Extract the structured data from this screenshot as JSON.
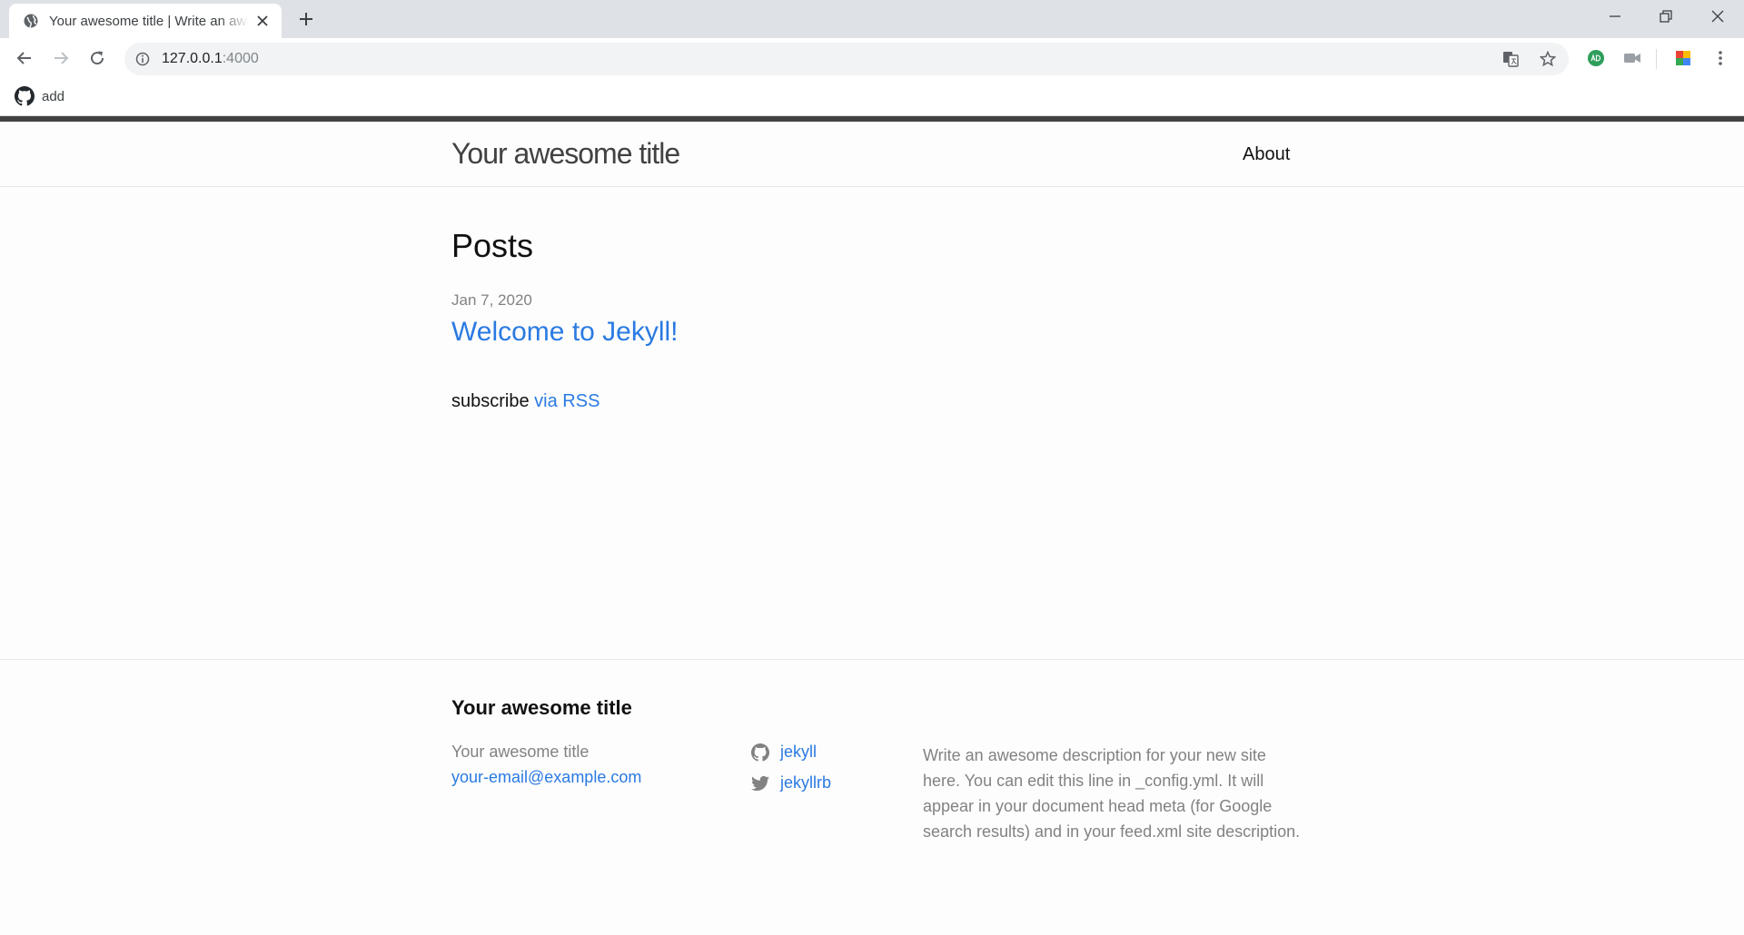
{
  "browser": {
    "tab_title": "Your awesome title | Write an awesome description for your new site",
    "url_host": "127.0.0.1",
    "url_port": ":4000",
    "bookmark_label": "add"
  },
  "site": {
    "title": "Your awesome title",
    "nav": {
      "about": "About"
    }
  },
  "main": {
    "posts_heading": "Posts",
    "posts": [
      {
        "date": "Jan 7, 2020",
        "title": "Welcome to Jekyll!"
      }
    ],
    "subscribe_text": "subscribe",
    "rss_link": "via RSS"
  },
  "footer": {
    "heading": "Your awesome title",
    "name": "Your awesome title",
    "email": "your-email@example.com",
    "github": "jekyll",
    "twitter": "jekyllrb",
    "description": "Write an awesome description for your new site here. You can edit this line in _config.yml. It will appear in your document head meta (for Google search results) and in your feed.xml site description."
  },
  "colors": {
    "link": "#2a7ae2",
    "muted": "#828282",
    "text": "#111111",
    "header_stripe": "#424242",
    "tabbar": "#dee1e6"
  },
  "icons": {
    "tab_favicon": "globe-icon",
    "bookmark": "github-icon",
    "footer_github": "github-icon",
    "footer_twitter": "twitter-icon"
  }
}
